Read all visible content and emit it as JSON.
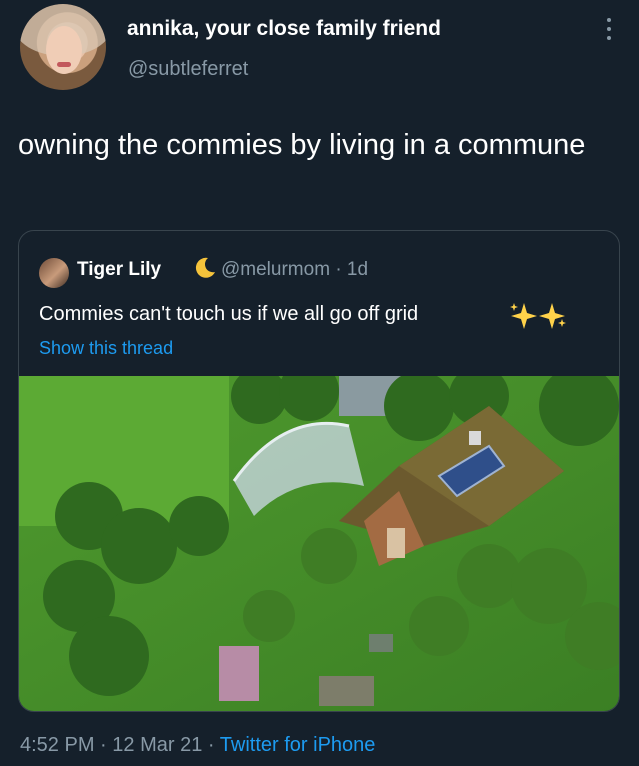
{
  "tweet": {
    "author_name": "annika, your close family friend",
    "author_handle": "@subtleferret",
    "text": "owning the commies by living in a commune",
    "time": "4:52 PM",
    "date": "12 Mar 21",
    "separator": "·",
    "source": "Twitter for iPhone"
  },
  "quoted": {
    "author_name": "Tiger Lily",
    "author_handle": "@melurmom",
    "age": "· 1d",
    "text": "Commies can't touch us if we all go off grid",
    "show_thread": "Show this thread"
  },
  "colors": {
    "background": "#15202b",
    "secondary_text": "#8899a6",
    "link": "#1d9bf0",
    "border": "#38444d"
  }
}
